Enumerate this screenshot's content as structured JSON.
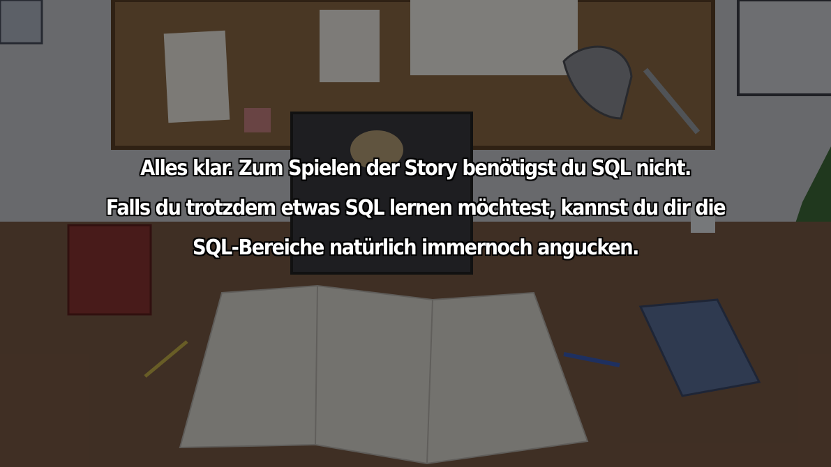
{
  "dialog": {
    "lines": [
      "Alles klar. Zum Spielen der Story benötigst du SQL nicht.",
      "Falls du trotzdem etwas SQL lernen möchtest, kannst du dir die",
      "SQL-Bereiche natürlich immernoch angucken."
    ]
  },
  "colors": {
    "wall": "#c9ccd0",
    "corkboard": "#8a6742",
    "desk": "#7a5a45",
    "overlay": "#000000",
    "text": "#ffffff",
    "text_outline": "#000000"
  }
}
